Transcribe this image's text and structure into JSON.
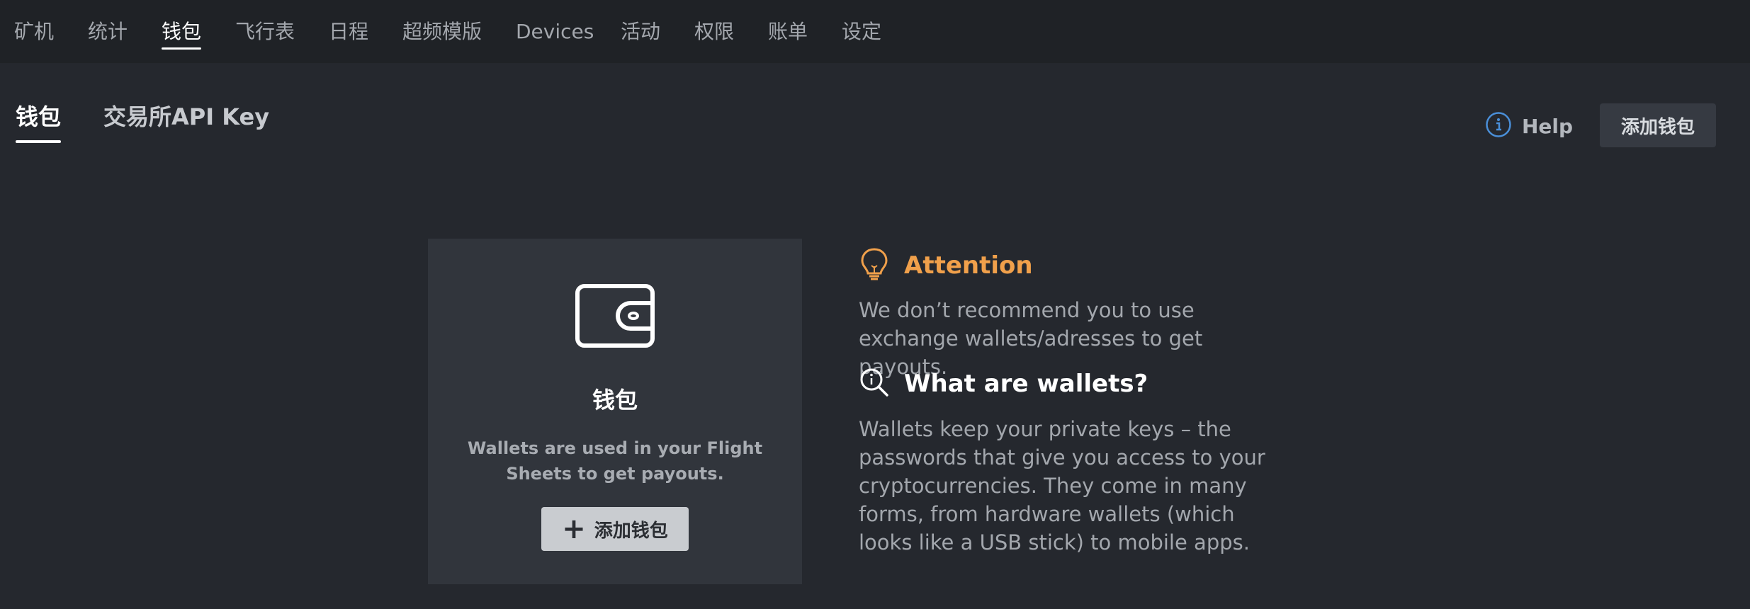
{
  "nav": {
    "tabs": [
      {
        "label": "矿机"
      },
      {
        "label": "统计"
      },
      {
        "label": "钱包"
      },
      {
        "label": "飞行表"
      },
      {
        "label": "日程"
      },
      {
        "label": "超频模版"
      },
      {
        "label": "Devices"
      },
      {
        "label": "活动"
      },
      {
        "label": "权限"
      },
      {
        "label": "账单"
      },
      {
        "label": "设定"
      }
    ],
    "active": "钱包"
  },
  "subtabs": [
    {
      "label": "钱包"
    },
    {
      "label": "交易所API Key"
    }
  ],
  "header": {
    "help_label": "Help",
    "add_wallet_label": "添加钱包"
  },
  "card": {
    "icon": "wallet-icon",
    "title": "钱包",
    "description": "Wallets are used in your Flight Sheets to get payouts.",
    "add_button_label": "添加钱包"
  },
  "attention": {
    "icon": "lightbulb-icon",
    "title": "Attention",
    "text": "We don’t recommend you to use exchange wallets/adresses to get payouts."
  },
  "what_are_wallets": {
    "icon": "search-info-icon",
    "title": "What are wallets?",
    "text": "Wallets keep your private keys – the passwords that give you access to your cryptocurrencies. They come in many forms, from hardware wallets (which looks like a USB stick) to mobile apps."
  },
  "colors": {
    "background": "#25282e",
    "nav_background": "#1f2226",
    "card_background": "#31353c",
    "attention_accent": "#f0a04b",
    "help_icon": "#4a8fd8"
  }
}
